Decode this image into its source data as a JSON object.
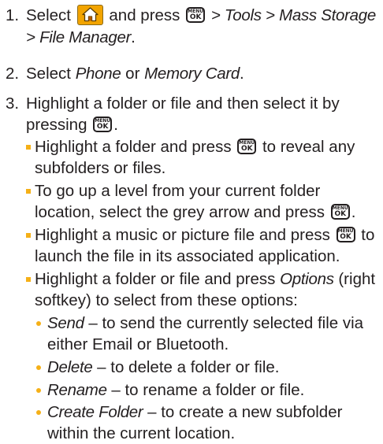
{
  "steps": [
    {
      "number": "1.",
      "t1": "Select",
      "t2": "and press",
      "t3": "> Tools > Mass Storage > File Manager",
      "t4": "."
    },
    {
      "number": "2.",
      "t1": "Select",
      "t2": "Phone",
      "t3": "or",
      "t4": "Memory Card",
      "t5": "."
    },
    {
      "number": "3.",
      "t1": "Highlight a folder or file and then select it by pressing",
      "t2": "."
    }
  ],
  "bullets": [
    {
      "t1": "Highlight a folder and press",
      "t2": "to reveal any subfolders or files."
    },
    {
      "t1": "To go up a level from your current folder location, select the grey arrow and press",
      "t2": "."
    },
    {
      "t1": "Highlight a music or picture file and press",
      "t2": "to launch the file in its associated application."
    },
    {
      "t1": "Highlight a folder or file and press",
      "t2": "Options",
      "t3": "(right softkey) to select from these options:"
    }
  ],
  "options": [
    {
      "name": "Send",
      "desc": "– to send the currently selected file via either Email or Bluetooth."
    },
    {
      "name": "Delete",
      "desc": "– to delete a folder or file."
    },
    {
      "name": "Rename",
      "desc": "– to rename a folder or file."
    },
    {
      "name": "Create Folder",
      "desc": "– to create a new subfolder within the current location."
    }
  ],
  "icons": {
    "home": "home-key-icon",
    "menu_ok": "menu-ok-key-icon",
    "menu_ok_line1": "MENU",
    "menu_ok_line2": "OK",
    "accent_color": "#f5b018",
    "home_color": "#f2a400"
  }
}
